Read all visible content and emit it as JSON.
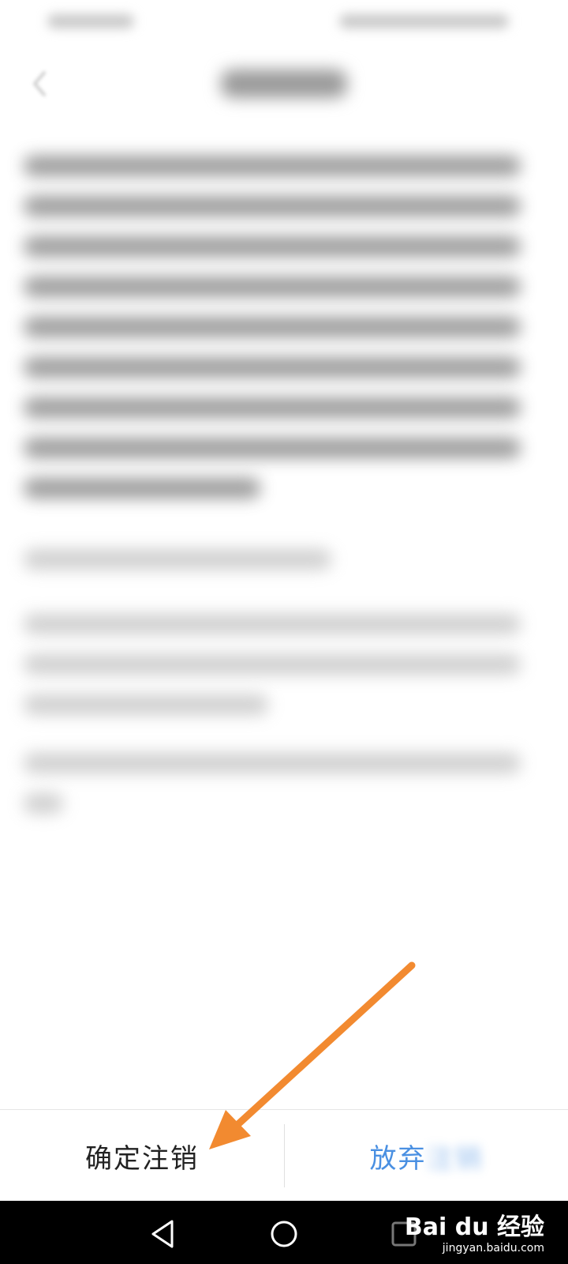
{
  "footer": {
    "confirm_label": "确定注销",
    "cancel_label_visible": "放弃",
    "cancel_label_faded": "注销"
  },
  "watermark": {
    "logo_text": "Bai du 经验",
    "url": "jingyan.baidu.com"
  },
  "colors": {
    "annotation_arrow": "#F28A30",
    "cancel_text": "#4A90E2"
  },
  "icons": [
    "back-icon",
    "nav-back-icon",
    "nav-home-icon",
    "nav-recents-icon",
    "annotation-arrow-icon"
  ]
}
